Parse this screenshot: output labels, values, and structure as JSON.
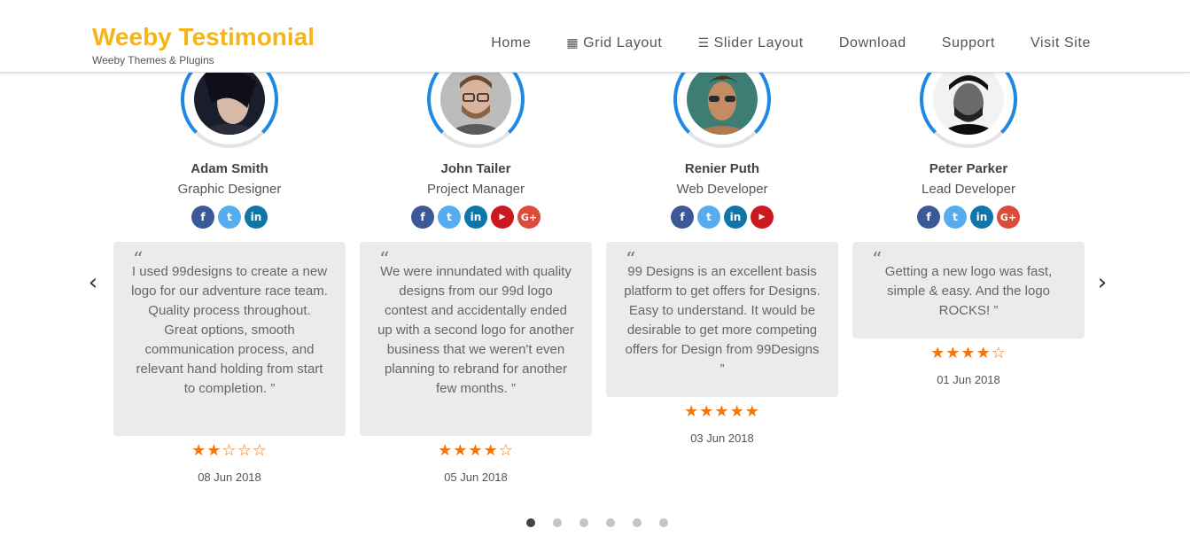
{
  "header": {
    "brand": "Weeby Testimonial",
    "tagline": "Weeby Themes & Plugins",
    "brand_color": "#f5b51a",
    "nav": [
      {
        "label": "Home",
        "icon": ""
      },
      {
        "label": "Grid Layout",
        "icon": "grid-icon"
      },
      {
        "label": "Slider Layout",
        "icon": "sliders-icon"
      },
      {
        "label": "Download",
        "icon": ""
      },
      {
        "label": "Support",
        "icon": ""
      },
      {
        "label": "Visit Site",
        "icon": ""
      }
    ]
  },
  "colors": {
    "ring_accent": "#1e88e5",
    "star": "#f4750a",
    "quote_bg": "#ebebeb",
    "facebook": "#3b5998",
    "twitter": "#55acee",
    "linkedin": "#0e76a8",
    "youtube": "#cc181e",
    "google_plus": "#dd4b39"
  },
  "testimonials": [
    {
      "name": "Adam Smith",
      "role": "Graphic Designer",
      "socials": [
        "facebook",
        "twitter",
        "linkedin"
      ],
      "quote": "I used 99designs to create a new logo for our adventure race team. Quality process throughout. Great options, smooth communication process, and relevant hand holding from start to completion. ”",
      "rating": 2,
      "rating_max": 5,
      "date": "08 Jun 2018"
    },
    {
      "name": "John Tailer",
      "role": "Project Manager",
      "socials": [
        "facebook",
        "twitter",
        "linkedin",
        "youtube",
        "google-plus"
      ],
      "quote": "We were innundated with quality designs from our 99d logo contest and accidentally ended up with a second logo for another business that we weren't even planning to rebrand for another few months. ”",
      "rating": 4,
      "rating_max": 5,
      "date": "05 Jun 2018"
    },
    {
      "name": "Renier Puth",
      "role": "Web Developer",
      "socials": [
        "facebook",
        "twitter",
        "linkedin",
        "youtube"
      ],
      "quote": "99 Designs is an excellent basis platform to get offers for Designs. Easy to understand. It would be desirable to get more competing offers for Design from 99Designs ”",
      "rating": 5,
      "rating_max": 5,
      "date": "03 Jun 2018"
    },
    {
      "name": "Peter Parker",
      "role": "Lead Developer",
      "socials": [
        "facebook",
        "twitter",
        "linkedin",
        "google-plus"
      ],
      "quote": "Getting a new logo was fast, simple & easy. And the logo ROCKS! ”",
      "rating": 4,
      "rating_max": 5,
      "date": "01 Jun 2018"
    }
  ],
  "quote_open": "“",
  "pagination": {
    "pages": 6,
    "active": 1
  }
}
